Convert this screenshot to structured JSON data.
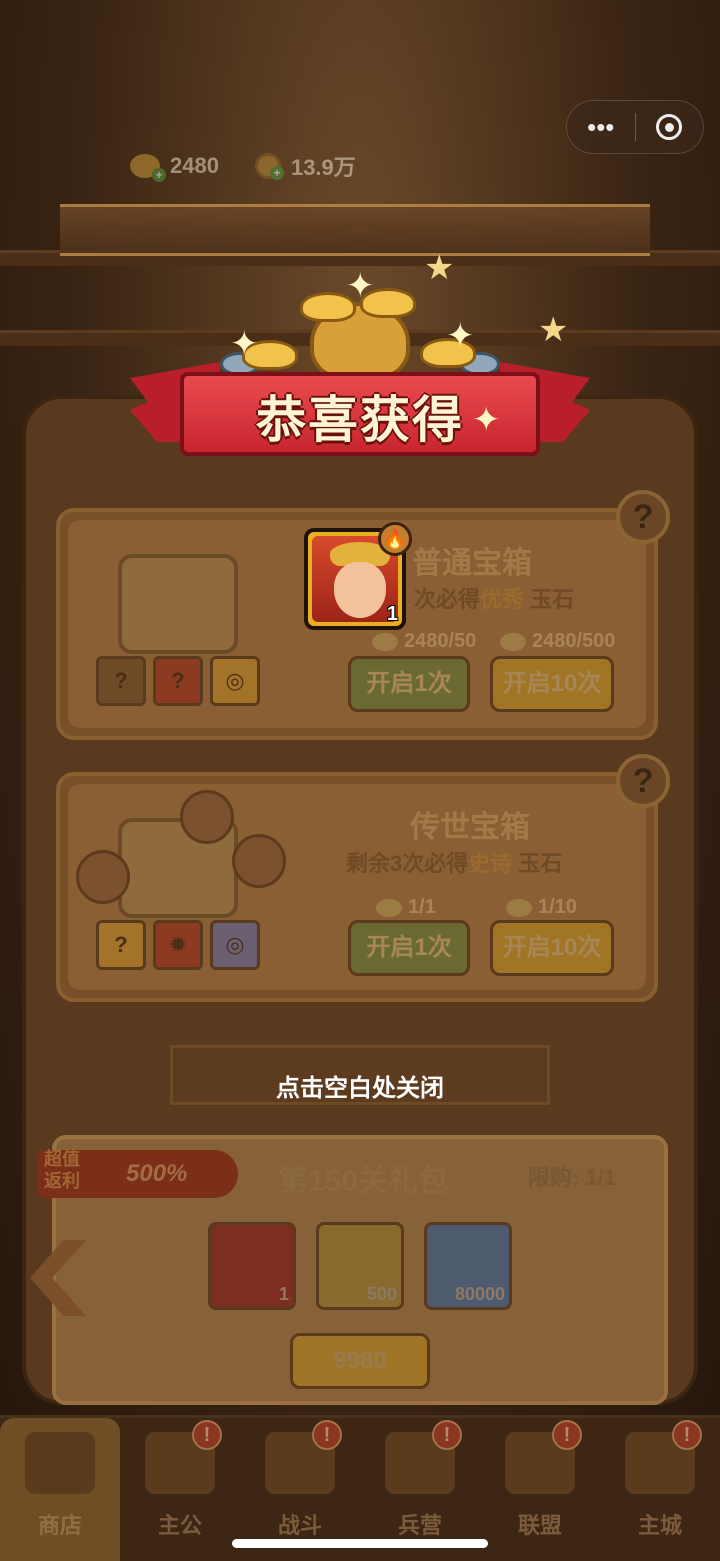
{
  "currency": [
    {
      "icon": "gold-ingot-icon",
      "value": "2480"
    },
    {
      "icon": "copper-coin-icon",
      "value": "13.9万"
    }
  ],
  "capsule": {
    "more": "•••",
    "close_icon": "target-icon"
  },
  "reward": {
    "title": "恭喜获得",
    "item_count": "1"
  },
  "chest_normal": {
    "title": "普通宝箱",
    "sub_prefix": "次必得",
    "sub_highlight": "优秀",
    "sub_suffix": "玉石",
    "cost1": "2480/50",
    "cost2": "2480/500",
    "btn1": "开启1次",
    "btn10": "开启10次",
    "help": "?"
  },
  "chest_legend": {
    "title": "传世宝箱",
    "sub_prefix": "剩余3次必得",
    "sub_highlight": "史诗",
    "sub_suffix": "玉石",
    "cost1": "1/1",
    "cost2": "1/10",
    "btn1": "开启1次",
    "btn10": "开启10次",
    "help": "?"
  },
  "close_tip": "点击空白处关闭",
  "pack": {
    "tag_line1": "超值",
    "tag_line2": "返利",
    "tag_percent": "500%",
    "name": "第150关礼包",
    "limit": "限购: 1/1",
    "items": [
      {
        "count": "1",
        "color": "#7c2f20"
      },
      {
        "count": "500",
        "color": "#8a6a2e"
      },
      {
        "count": "80000",
        "color": "#4e5a6e"
      }
    ],
    "price": "9980"
  },
  "nav": [
    {
      "label": "商店",
      "active": true,
      "badge": ""
    },
    {
      "label": "主公",
      "active": false,
      "badge": "!"
    },
    {
      "label": "战斗",
      "active": false,
      "badge": "!"
    },
    {
      "label": "兵营",
      "active": false,
      "badge": "!"
    },
    {
      "label": "联盟",
      "active": false,
      "badge": "!"
    },
    {
      "label": "主城",
      "active": false,
      "badge": "!"
    }
  ]
}
